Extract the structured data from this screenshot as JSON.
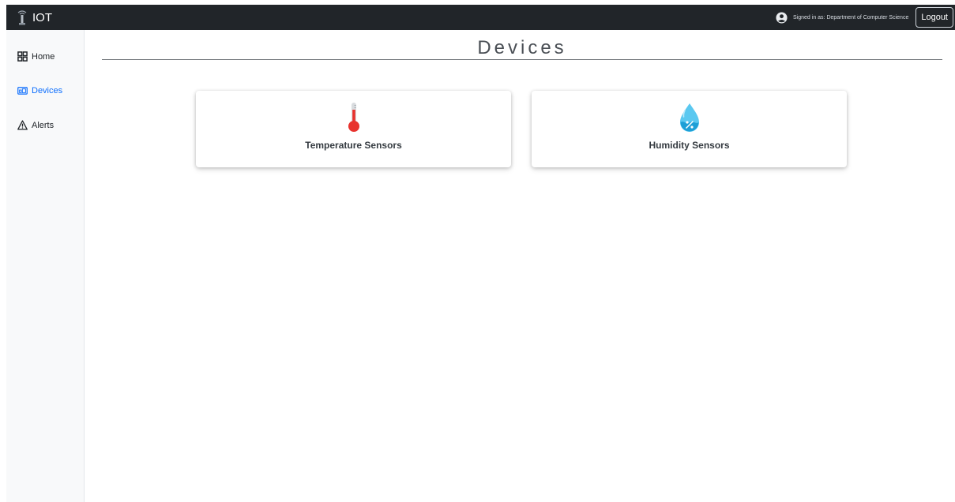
{
  "brand": {
    "name": "IOT",
    "logo_icon": "iot-tower-icon"
  },
  "header": {
    "user_icon": "user-circle-icon",
    "signed_in_text": "Signed in as: Department of Computer Science",
    "logout_label": "Logout"
  },
  "sidebar": {
    "active_color": "#0d6efd",
    "items": [
      {
        "label": "Home",
        "icon": "grid-icon",
        "active": false
      },
      {
        "label": "Devices",
        "icon": "devices-icon",
        "active": true
      },
      {
        "label": "Alerts",
        "icon": "warning-icon",
        "active": false
      }
    ]
  },
  "main": {
    "title": "Devices",
    "cards": [
      {
        "label": "Temperature Sensors",
        "icon": "thermometer-icon"
      },
      {
        "label": "Humidity Sensors",
        "icon": "humidity-drop-icon"
      }
    ]
  },
  "colors": {
    "topbar": "#212529",
    "sidebar": "#f8f9fa",
    "thermometer": "#e8332e",
    "drop": "#5ac8f0"
  }
}
